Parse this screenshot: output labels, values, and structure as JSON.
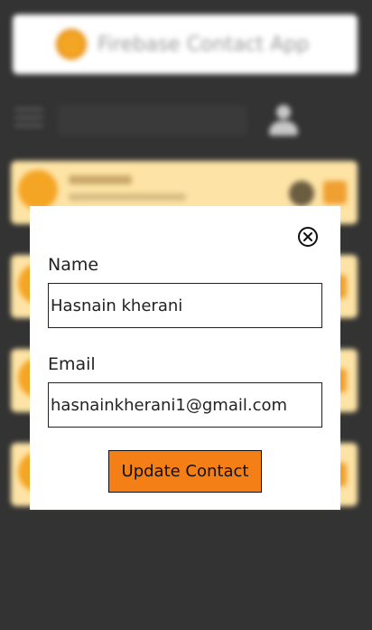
{
  "app": {
    "title": "Firebase Contact App"
  },
  "modal": {
    "name_label": "Name",
    "name_value": "Hasnain kherani",
    "email_label": "Email",
    "email_value": "hasnainkherani1@gmail.com",
    "update_button_label": "Update Contact",
    "close_icon": "close-circle-icon"
  },
  "colors": {
    "background": "#333333",
    "accent": "#f57f17",
    "card": "#fde3a5"
  }
}
